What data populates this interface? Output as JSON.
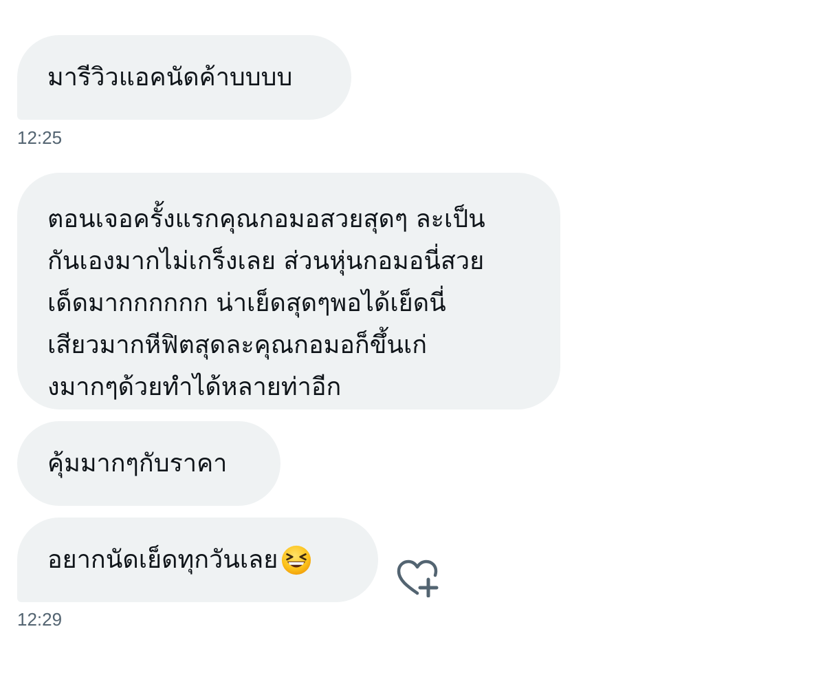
{
  "messages": [
    {
      "text": "มารีวิวแอคนัดค้าบบบบ"
    },
    {
      "lines": [
        "ตอนเจอครั้งแรกคุณกอมอสวยสุดๆ ละเป็น",
        "กันเองมากไม่เกร็งเลย ส่วนหุ่นกอมอนี่สวย",
        "เด็ดมากกกกกก น่าเย็ดสุดๆพอได้เย็ดนี่",
        "เสียวมากหีฟิตสุดละคุณกอมอก็ขึ้นเก่",
        "งมากๆด้วยทำได้หลายท่าอีก"
      ]
    },
    {
      "text": "คุ้มมากๆกับราคา"
    },
    {
      "text": "อยากนัดเย็ดทุกวันเลย",
      "emoji": "grinning-squinting-face-icon"
    }
  ],
  "timestamps": [
    "12:25",
    "12:29"
  ],
  "reaction_icon": "heart-plus-icon",
  "colors": {
    "bubble_bg": "#eff2f3",
    "text": "#0f1419",
    "timestamp": "#536471",
    "icon": "#536471"
  }
}
